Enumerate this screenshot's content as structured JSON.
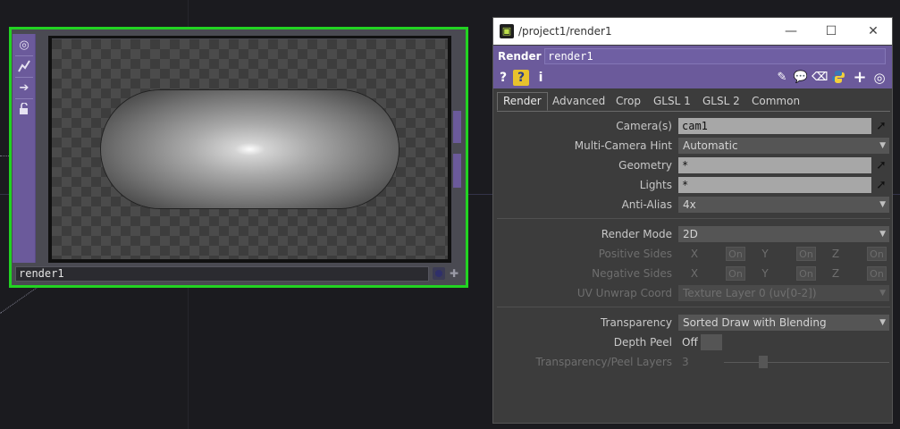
{
  "node": {
    "name": "render1",
    "side_icons": [
      "target-icon",
      "graph-icon",
      "arrow-right-icon",
      "lock-icon"
    ]
  },
  "window": {
    "path": "/project1/render1",
    "op_type": "Render",
    "op_name": "render1",
    "toolbar_help": "?",
    "toolbar_info": "i",
    "controls": {
      "minimize": "—",
      "maximize": "☐",
      "close": "✕"
    }
  },
  "tabs": [
    "Render",
    "Advanced",
    "Crop",
    "GLSL 1",
    "GLSL 2",
    "Common"
  ],
  "params": {
    "cameras": {
      "label": "Camera(s)",
      "value": "cam1"
    },
    "multi_camera_hint": {
      "label": "Multi-Camera Hint",
      "value": "Automatic"
    },
    "geometry": {
      "label": "Geometry",
      "value": "*"
    },
    "lights": {
      "label": "Lights",
      "value": "*"
    },
    "anti_alias": {
      "label": "Anti-Alias",
      "value": "4x"
    },
    "render_mode": {
      "label": "Render Mode",
      "value": "2D"
    },
    "positive_sides": {
      "label": "Positive Sides",
      "x": "X",
      "y": "Y",
      "z": "Z",
      "on": "On"
    },
    "negative_sides": {
      "label": "Negative Sides",
      "x": "X",
      "y": "Y",
      "z": "Z",
      "on": "On"
    },
    "uv_unwrap": {
      "label": "UV Unwrap Coord",
      "value": "Texture Layer 0 (uv[0-2])"
    },
    "transparency": {
      "label": "Transparency",
      "value": "Sorted Draw with Blending"
    },
    "depth_peel": {
      "label": "Depth Peel",
      "value": "Off"
    },
    "peel_layers": {
      "label": "Transparency/Peel Layers",
      "value": "3"
    }
  },
  "colors": {
    "node_border": "#22d322",
    "operator_purple": "#6b5a9b",
    "panel_bg": "#3c3c3c"
  }
}
